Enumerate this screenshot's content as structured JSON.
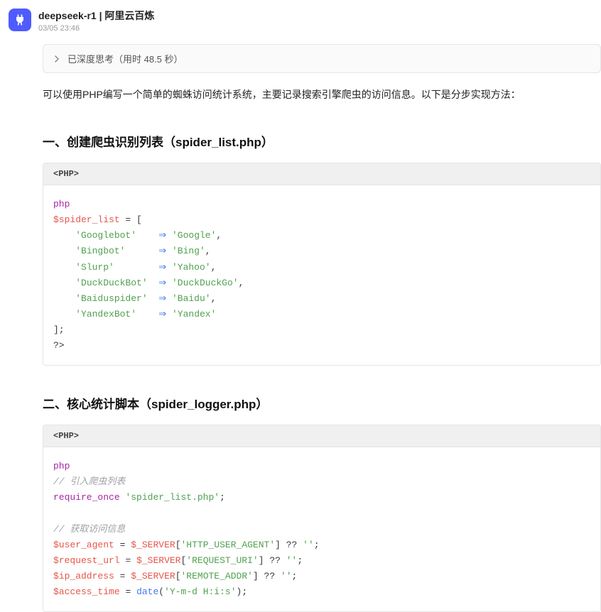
{
  "header": {
    "bot_name": "deepseek-r1 | 阿里云百炼",
    "timestamp": "03/05 23:46"
  },
  "thought": {
    "text": "已深度思考（用时 48.5 秒）"
  },
  "intro": "可以使用PHP编写一个简单的蜘蛛访问统计系统，主要记录搜索引擎爬虫的访问信息。以下是分步实现方法：",
  "sections": [
    {
      "title": "一、创建爬虫识别列表（spider_list.php）",
      "lang": "<PHP>"
    },
    {
      "title": "二、核心统计脚本（spider_logger.php）",
      "lang": "<PHP>"
    }
  ],
  "code1": {
    "open": "<?",
    "php": "php",
    "l1_var": "$spider_list",
    "l1_rest": " = [",
    "rows": [
      {
        "k": "'Googlebot'",
        "pad": "    ",
        "v": "'Google'",
        "t": ","
      },
      {
        "k": "'Bingbot'",
        "pad": "      ",
        "v": "'Bing'",
        "t": ","
      },
      {
        "k": "'Slurp'",
        "pad": "        ",
        "v": "'Yahoo'",
        "t": ","
      },
      {
        "k": "'DuckDuckBot'",
        "pad": "  ",
        "v": "'DuckDuckGo'",
        "t": ","
      },
      {
        "k": "'Baiduspider'",
        "pad": "  ",
        "v": "'Baidu'",
        "t": ","
      },
      {
        "k": "'YandexBot'",
        "pad": "    ",
        "v": "'Yandex'",
        "t": ""
      }
    ],
    "close1": "];",
    "close2": "?>"
  },
  "code2": {
    "open": "<?",
    "php": "php",
    "c1": "// 引入爬虫列表",
    "l_req_kw": "require_once",
    "l_req_str": "'spider_list.php'",
    "c2": "// 获取访问信息",
    "vars": [
      {
        "v": "$user_agent",
        "s": "$_SERVER",
        "k": "'HTTP_USER_AGENT'",
        "d": "''"
      },
      {
        "v": "$request_url",
        "s": "$_SERVER",
        "k": "'REQUEST_URI'",
        "d": "''"
      },
      {
        "v": "$ip_address",
        "s": "$_SERVER",
        "k": "'REMOTE_ADDR'",
        "d": "''"
      }
    ],
    "l_time_v": "$access_time",
    "l_time_fn": "date",
    "l_time_str": "'Y-m-d H:i:s'"
  }
}
